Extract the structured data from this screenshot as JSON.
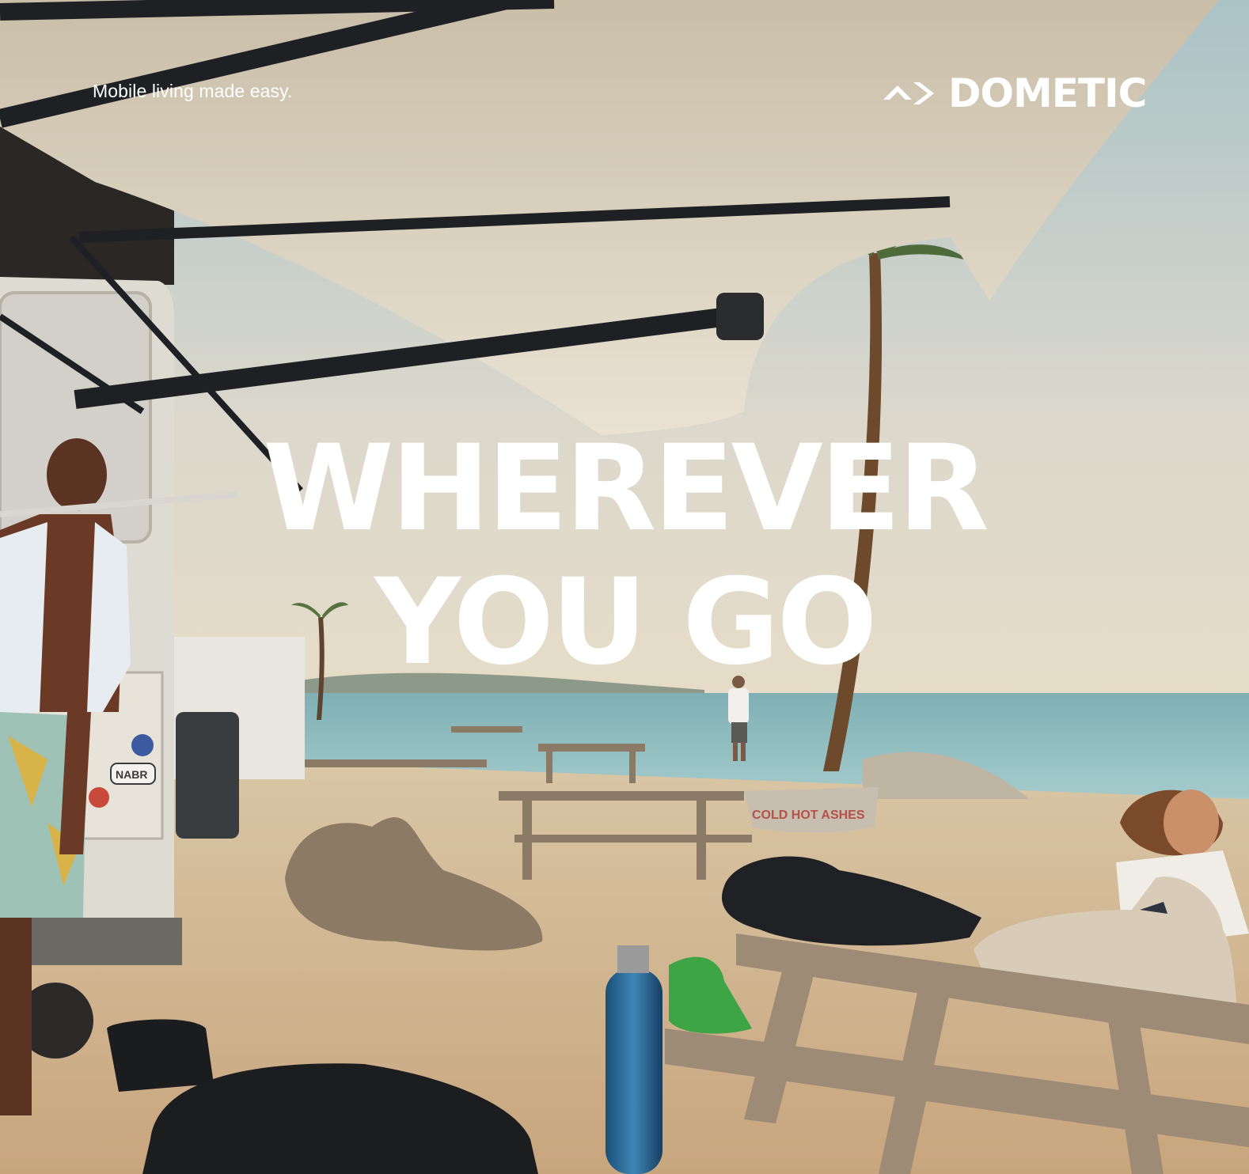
{
  "ad": {
    "tagline": "Mobile living made easy.",
    "brand": "DOMETIC",
    "headline_line1": "WHEREVER",
    "headline_line2": "YOU GO",
    "sign_text": "COLD HOT ASHES",
    "sticker_text": "NABR"
  },
  "colors": {
    "sky": "#c9d6d6",
    "sea": "#7fb3b8",
    "sand": "#d8c3a0",
    "awning": "#e8e0d0",
    "headline": "#ffffff"
  },
  "icons": {
    "logo_mark": "dometic-chevrons-icon"
  }
}
